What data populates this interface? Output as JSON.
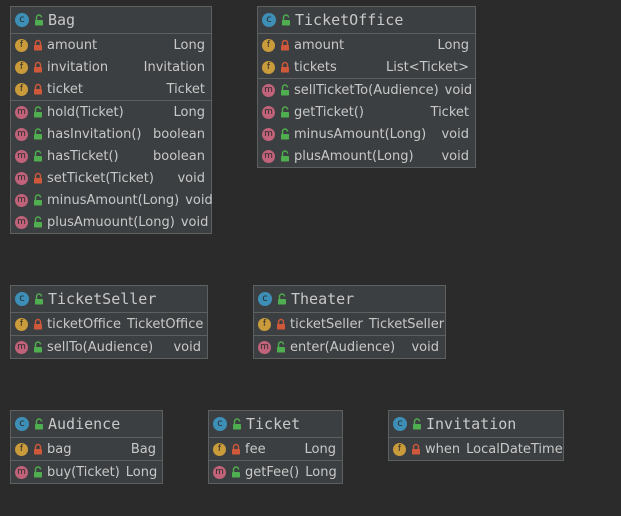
{
  "colors": {
    "background": "#2b2b2b",
    "box_fill": "#3c3f41",
    "box_border": "#5e6060",
    "class_icon": "#3d8fb7",
    "field_icon": "#c99b3a",
    "method_icon": "#c0637a",
    "private_lock": "#d0583a",
    "public_lock": "#4fae4f"
  },
  "icon_letters": {
    "class": "c",
    "field": "f",
    "method": "m"
  },
  "classes": [
    {
      "name": "Bag",
      "fields": [
        {
          "name": "amount",
          "type": "Long",
          "visibility": "private"
        },
        {
          "name": "invitation",
          "type": "Invitation",
          "visibility": "private"
        },
        {
          "name": "ticket",
          "type": "Ticket",
          "visibility": "private"
        }
      ],
      "methods": [
        {
          "name": "hold(Ticket)",
          "type": "Long",
          "visibility": "public"
        },
        {
          "name": "hasInvitation()",
          "type": "boolean",
          "visibility": "public"
        },
        {
          "name": "hasTicket()",
          "type": "boolean",
          "visibility": "public"
        },
        {
          "name": "setTicket(Ticket)",
          "type": "void",
          "visibility": "private"
        },
        {
          "name": "minusAmount(Long)",
          "type": "void",
          "visibility": "public"
        },
        {
          "name": "plusAmuount(Long)",
          "type": "void",
          "visibility": "public"
        }
      ]
    },
    {
      "name": "TicketOffice",
      "fields": [
        {
          "name": "amount",
          "type": "Long",
          "visibility": "private"
        },
        {
          "name": "tickets",
          "type": "List<Ticket>",
          "visibility": "private"
        }
      ],
      "methods": [
        {
          "name": "sellTicketTo(Audience)",
          "type": "void",
          "visibility": "public"
        },
        {
          "name": "getTicket()",
          "type": "Ticket",
          "visibility": "public"
        },
        {
          "name": "minusAmount(Long)",
          "type": "void",
          "visibility": "public"
        },
        {
          "name": "plusAmount(Long)",
          "type": "void",
          "visibility": "public"
        }
      ]
    },
    {
      "name": "TicketSeller",
      "fields": [
        {
          "name": "ticketOffice",
          "type": "TicketOffice",
          "visibility": "private"
        }
      ],
      "methods": [
        {
          "name": "sellTo(Audience)",
          "type": "void",
          "visibility": "public"
        }
      ]
    },
    {
      "name": "Theater",
      "fields": [
        {
          "name": "ticketSeller",
          "type": "TicketSeller",
          "visibility": "private"
        }
      ],
      "methods": [
        {
          "name": "enter(Audience)",
          "type": "void",
          "visibility": "public"
        }
      ]
    },
    {
      "name": "Audience",
      "fields": [
        {
          "name": "bag",
          "type": "Bag",
          "visibility": "private"
        }
      ],
      "methods": [
        {
          "name": "buy(Ticket)",
          "type": "Long",
          "visibility": "public"
        }
      ]
    },
    {
      "name": "Ticket",
      "fields": [
        {
          "name": "fee",
          "type": "Long",
          "visibility": "private"
        }
      ],
      "methods": [
        {
          "name": "getFee()",
          "type": "Long",
          "visibility": "public"
        }
      ]
    },
    {
      "name": "Invitation",
      "fields": [
        {
          "name": "when",
          "type": "LocalDateTime",
          "visibility": "private"
        }
      ],
      "methods": []
    }
  ]
}
